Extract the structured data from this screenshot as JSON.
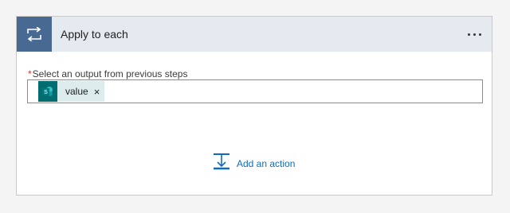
{
  "card": {
    "title": "Apply to each",
    "header_icon": "loop-icon",
    "header_color": "#486991",
    "more_icon": "more-options-icon"
  },
  "field": {
    "required_marker": "*",
    "label": "Select an output from previous steps",
    "token": {
      "icon": "sharepoint-icon",
      "icon_color": "#036c70",
      "label": "value",
      "remove_glyph": "×"
    }
  },
  "add_action": {
    "icon": "add-action-icon",
    "label": "Add an action",
    "color": "#0f6cbd"
  }
}
